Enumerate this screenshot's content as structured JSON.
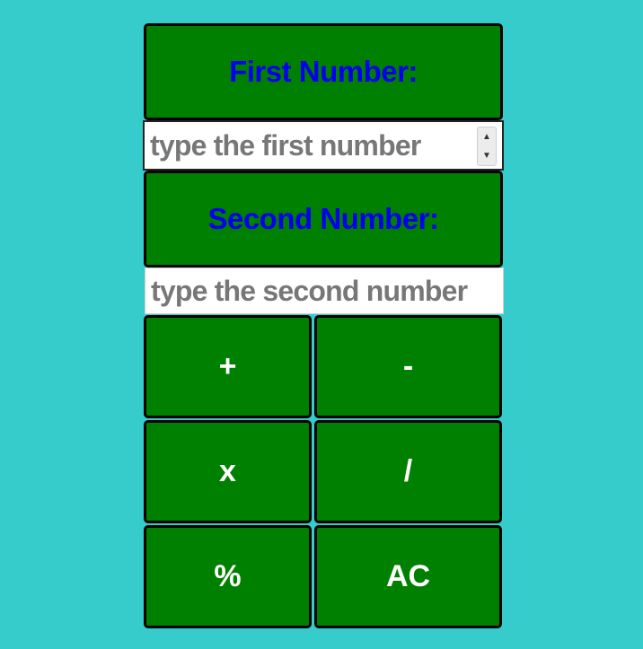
{
  "calculator": {
    "first_label": "First Number:",
    "first_placeholder": "type the first number",
    "second_label": "Second Number:",
    "second_placeholder": "type the second number",
    "buttons": {
      "add": "+",
      "subtract": "-",
      "multiply": "x",
      "divide": "/",
      "percent": "%",
      "clear": "AC"
    }
  },
  "colors": {
    "background": "#36cccc",
    "panel": "#008000",
    "label_text": "#0000ee",
    "button_text": "#ffffff"
  }
}
